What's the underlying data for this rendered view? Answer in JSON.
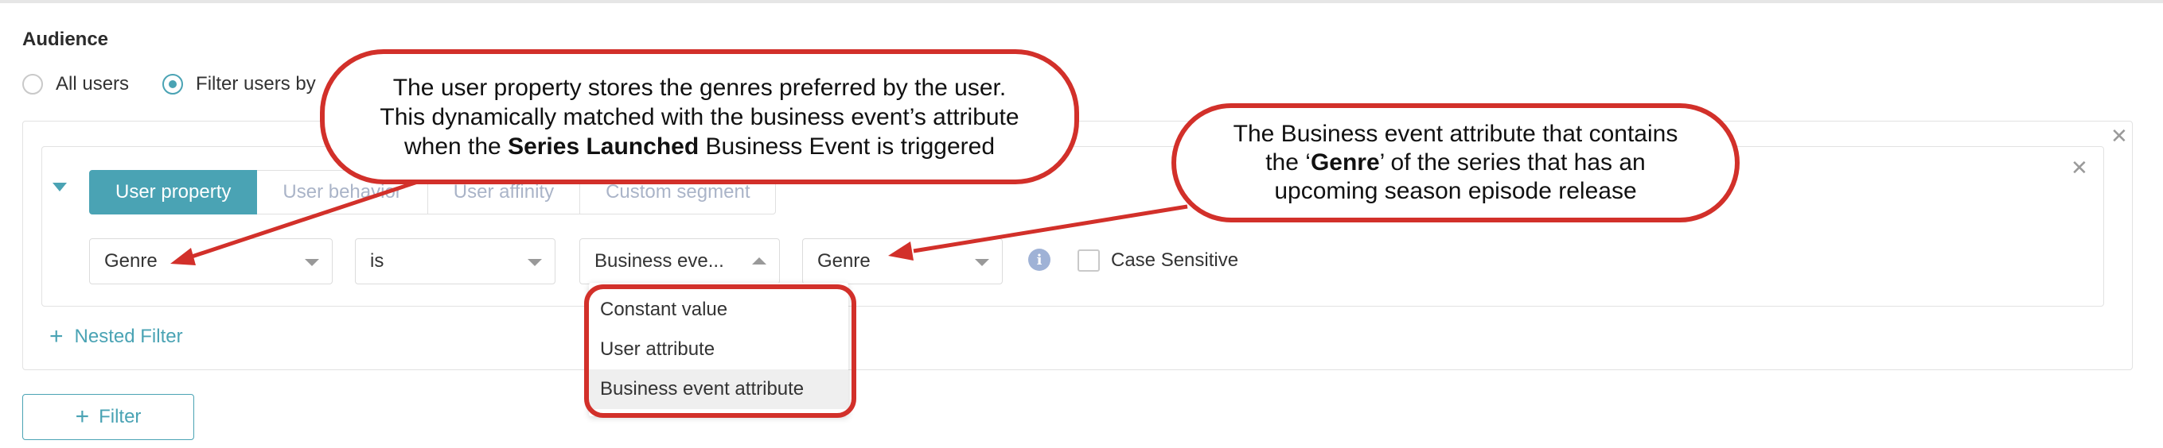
{
  "audience": {
    "title": "Audience",
    "radio_all_users": "All users",
    "radio_filter_users": "Filter users by",
    "selected_radio": "Filter users by"
  },
  "filter": {
    "tabs": [
      "User property",
      "User behavior",
      "User affinity",
      "Custom segment"
    ],
    "active_tab": "User property",
    "property_select": "Genre",
    "operator_select": "is",
    "value_type_select": "Business eve...",
    "attribute_select": "Genre",
    "case_sensitive_label": "Case Sensitive",
    "case_sensitive_checked": false,
    "info_icon_glyph": "i",
    "nested_filter_label": "Nested Filter",
    "add_filter_label": "Filter"
  },
  "dropdown": {
    "options": [
      "Constant value",
      "User attribute",
      "Business event attribute"
    ],
    "highlighted": "Business event attribute"
  },
  "callouts": {
    "left": {
      "line1": "The user property stores the genres preferred by the user.",
      "line2": "This dynamically matched with the business event’s attribute",
      "line3_pre": "when the ",
      "line3_bold": "Series Launched",
      "line3_post": " Business Event is triggered"
    },
    "right": {
      "line1": "The Business event attribute that contains",
      "line2_pre": "the ‘",
      "line2_bold": "Genre",
      "line2_post": "’ of the series that has an",
      "line3": "upcoming season episode release"
    }
  },
  "colors": {
    "accent": "#4aa3b4",
    "annotation_red": "#d2302a",
    "tab_inactive_text": "#aab4c8",
    "info_icon": "#9fb2d6"
  },
  "icons": {
    "close": "close-icon",
    "collapse": "caret-down-icon",
    "info": "info-icon",
    "add": "plus-icon"
  }
}
